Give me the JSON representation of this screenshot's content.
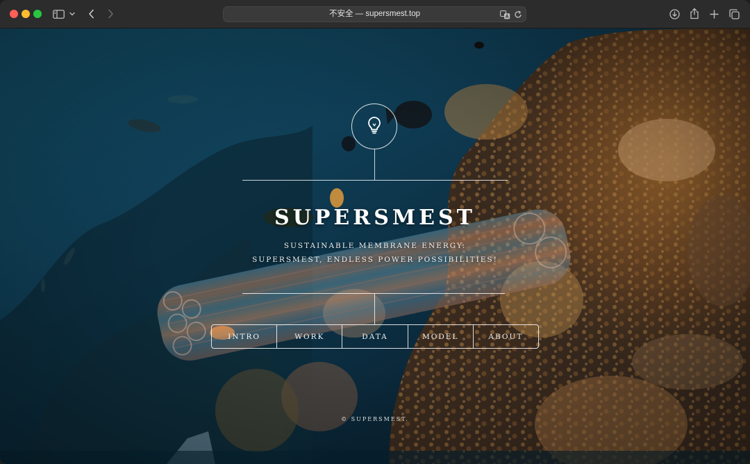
{
  "browser": {
    "url_text": "不安全 — supersmest.top"
  },
  "hero": {
    "title": "SUPERSMEST",
    "tagline_line1": "SUSTAINABLE MEMBRANE ENERGY:",
    "tagline_line2": "SUPERSMEST, ENDLESS POWER POSSIBILITIES!"
  },
  "nav": {
    "items": [
      {
        "label": "INTRO"
      },
      {
        "label": "WORK"
      },
      {
        "label": "DATA"
      },
      {
        "label": "MODEL"
      },
      {
        "label": "ABOUT"
      }
    ]
  },
  "footer": {
    "copyright": "© SUPERSMEST."
  },
  "colors": {
    "ocean_deep": "#0c2a3c",
    "ocean_mid": "#1c5f78",
    "coral": "#b07a3a",
    "traffic_red": "#ff5f57",
    "traffic_yellow": "#febc2e",
    "traffic_green": "#28c840"
  },
  "icons": [
    "sidebar-icon",
    "chevron-down-icon",
    "back-icon",
    "forward-icon",
    "translate-icon",
    "reload-icon",
    "download-icon",
    "share-icon",
    "new-tab-icon",
    "tab-overview-icon",
    "lightbulb-icon"
  ]
}
